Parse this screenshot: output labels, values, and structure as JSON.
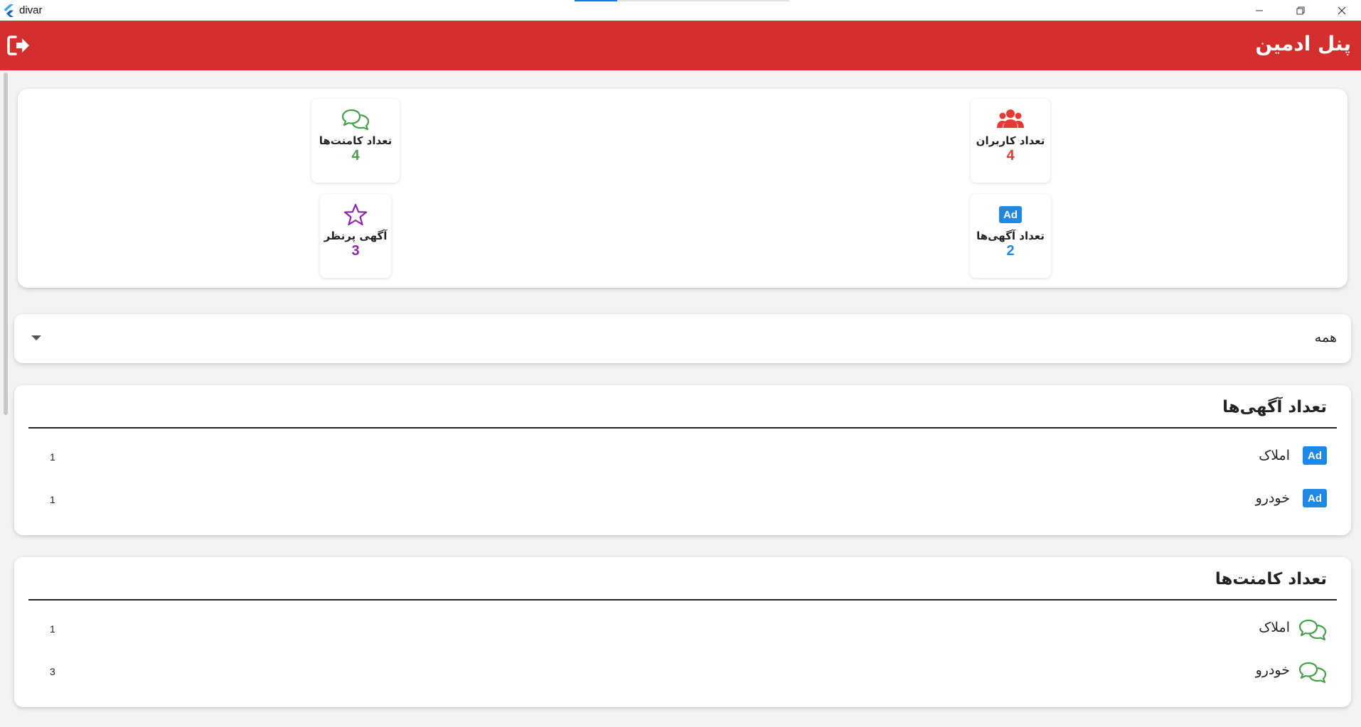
{
  "window": {
    "app_name": "divar"
  },
  "appbar": {
    "title": "پنل ادمین",
    "logout_icon": "logout-icon",
    "background_color": "#d32f2f"
  },
  "stats": {
    "users": {
      "label": "تعداد کاربران",
      "value": "4",
      "icon": "users-icon",
      "color": "#e53935"
    },
    "comments": {
      "label": "تعداد کامنت‌ها",
      "value": "4",
      "icon": "comments-icon",
      "color": "#43a047"
    },
    "ads": {
      "label": "تعداد آگهی‌ها",
      "value": "2",
      "icon": "ad-icon",
      "icon_text": "Ad",
      "color": "#1e88e5"
    },
    "popular_ads": {
      "label": "آگهی پرنظر",
      "value": "3",
      "icon": "star-icon",
      "color": "#8e24aa"
    }
  },
  "filter": {
    "selected": "همه"
  },
  "ads_list": {
    "title": "تعداد آگهی‌ها",
    "badge_text": "Ad",
    "rows": [
      {
        "label": "املاک",
        "count": "1"
      },
      {
        "label": "خودرو",
        "count": "1"
      }
    ]
  },
  "comments_list": {
    "title": "تعداد کامنت‌ها",
    "rows": [
      {
        "label": "املاک",
        "count": "1"
      },
      {
        "label": "خودرو",
        "count": "3"
      }
    ]
  }
}
